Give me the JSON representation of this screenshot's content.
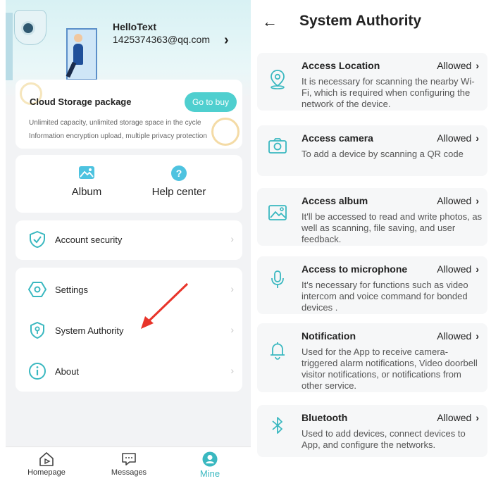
{
  "profile": {
    "name": "HelloText",
    "email": "1425374363@qq.com",
    "arrow": "›"
  },
  "storage": {
    "title": "Cloud Storage package",
    "line1": "Unlimited capacity, unlimited storage space in the cycle",
    "line2": "Information encryption upload, multiple privacy protection",
    "button": "Go to buy"
  },
  "quick": {
    "album": "Album",
    "help": "Help center"
  },
  "menu": {
    "account_security": "Account security",
    "settings": "Settings",
    "system_authority": "System Authority",
    "about": "About",
    "chevron": "›"
  },
  "tabbar": {
    "home": "Homepage",
    "messages": "Messages",
    "mine": "Mine"
  },
  "colors": {
    "accent": "#3ab8c0",
    "arrow": "#e8342a",
    "button": "#4fcfcf"
  },
  "authority": {
    "back": "←",
    "title": "System Authority",
    "items": [
      {
        "icon": "location-icon",
        "title": "Access Location",
        "status": "Allowed",
        "chev": "›",
        "desc": "It is necessary for scanning the nearby Wi-Fi, which is required when configuring the network of the device."
      },
      {
        "icon": "camera-icon",
        "title": "Access camera",
        "status": "Allowed",
        "chev": "›",
        "desc": "To add a device by scanning a QR code"
      },
      {
        "icon": "image-icon",
        "title": "Access album",
        "status": "Allowed",
        "chev": "›",
        "desc": "It'll be accessed to read and write photos, as well as scanning, file saving, and user feedback."
      },
      {
        "icon": "microphone-icon",
        "title": "Access to microphone",
        "status": "Allowed",
        "chev": "›",
        "desc": "It's necessary for functions such as video intercom and voice command for bonded devices ."
      },
      {
        "icon": "bell-icon",
        "title": "Notification",
        "status": "Allowed",
        "chev": "›",
        "desc": "Used for the App to receive camera-triggered alarm notifications, Video doorbell visitor notifications, or notifications from other service."
      },
      {
        "icon": "bluetooth-icon",
        "title": "Bluetooth",
        "status": "Allowed",
        "chev": "›",
        "desc": "Used to add devices, connect devices to App, and configure the networks."
      }
    ]
  }
}
